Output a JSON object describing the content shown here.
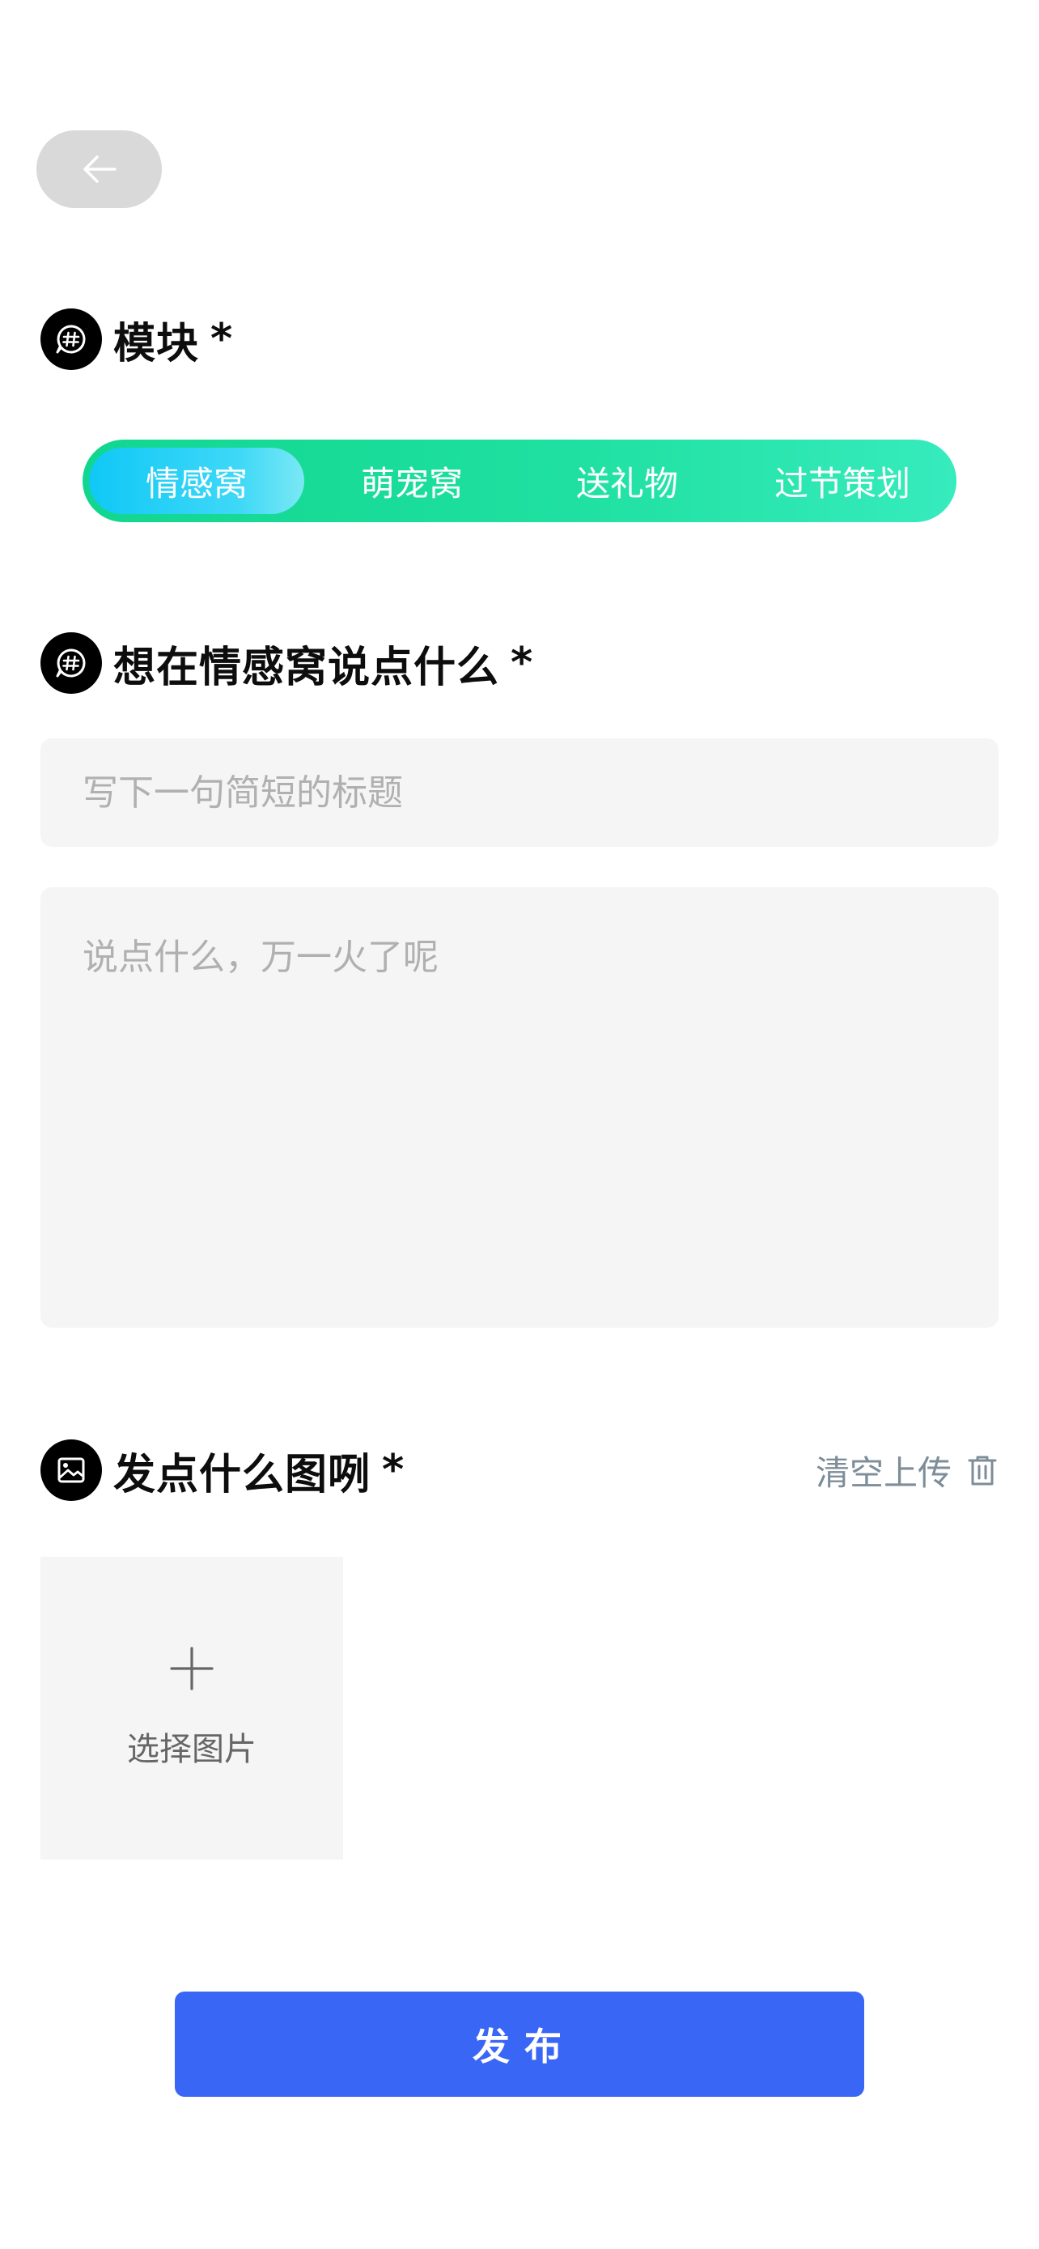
{
  "back": {
    "icon": "arrow-left-icon"
  },
  "module_section": {
    "icon": "hashtag-chat-icon",
    "title": "模块",
    "required_mark": "*",
    "tabs": [
      {
        "label": "情感窝",
        "active": true
      },
      {
        "label": "萌宠窝",
        "active": false
      },
      {
        "label": "送礼物",
        "active": false
      },
      {
        "label": "过节策划",
        "active": false
      }
    ]
  },
  "post_section": {
    "icon": "hashtag-chat-icon",
    "title": "想在情感窝说点什么",
    "required_mark": "*",
    "title_input": {
      "value": "",
      "placeholder": "写下一句简短的标题"
    },
    "body_input": {
      "value": "",
      "placeholder": "说点什么，万一火了呢"
    }
  },
  "image_section": {
    "icon": "image-icon",
    "title": "发点什么图咧",
    "required_mark": "*",
    "clear_label": "清空上传",
    "clear_icon": "trash-icon",
    "picker_icon": "plus-icon",
    "picker_label": "选择图片"
  },
  "publish": {
    "label": "发布"
  },
  "colors": {
    "segment_bg": "#1fe0a0",
    "segment_active": "#10c8f6",
    "publish_bg": "#3a66f5",
    "input_bg": "#f5f5f5",
    "muted_text": "#7d8d99"
  }
}
